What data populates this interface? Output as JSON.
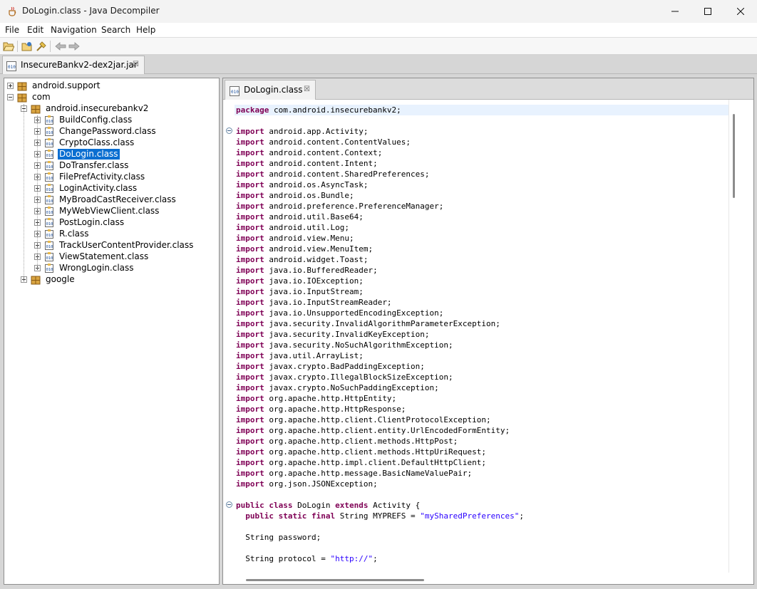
{
  "window": {
    "title": "DoLogin.class - Java Decompiler"
  },
  "menu": [
    "File",
    "Edit",
    "Navigation",
    "Search",
    "Help"
  ],
  "toolbar": {
    "icons": [
      "open-file-icon",
      "open-type-icon",
      "search-icon",
      "back-arrow-icon",
      "forward-arrow-icon"
    ]
  },
  "file_tab": {
    "label": "InsecureBankv2-dex2jar.jar",
    "close": "☒"
  },
  "editor_tab": {
    "label": "DoLogin.class",
    "close": "☒"
  },
  "tree": [
    {
      "label": "android.support",
      "level": 0,
      "expanded": false,
      "type": "package"
    },
    {
      "label": "com",
      "level": 0,
      "expanded": true,
      "type": "package"
    },
    {
      "label": "android.insecurebankv2",
      "level": 1,
      "expanded": true,
      "type": "package"
    },
    {
      "label": "BuildConfig.class",
      "level": 2,
      "expanded": false,
      "type": "class"
    },
    {
      "label": "ChangePassword.class",
      "level": 2,
      "expanded": false,
      "type": "class"
    },
    {
      "label": "CryptoClass.class",
      "level": 2,
      "expanded": false,
      "type": "class"
    },
    {
      "label": "DoLogin.class",
      "level": 2,
      "expanded": false,
      "type": "class",
      "selected": true
    },
    {
      "label": "DoTransfer.class",
      "level": 2,
      "expanded": false,
      "type": "class"
    },
    {
      "label": "FilePrefActivity.class",
      "level": 2,
      "expanded": false,
      "type": "class"
    },
    {
      "label": "LoginActivity.class",
      "level": 2,
      "expanded": false,
      "type": "class"
    },
    {
      "label": "MyBroadCastReceiver.class",
      "level": 2,
      "expanded": false,
      "type": "class"
    },
    {
      "label": "MyWebViewClient.class",
      "level": 2,
      "expanded": false,
      "type": "class"
    },
    {
      "label": "PostLogin.class",
      "level": 2,
      "expanded": false,
      "type": "class"
    },
    {
      "label": "R.class",
      "level": 2,
      "expanded": false,
      "type": "class"
    },
    {
      "label": "TrackUserContentProvider.class",
      "level": 2,
      "expanded": false,
      "type": "class"
    },
    {
      "label": "ViewStatement.class",
      "level": 2,
      "expanded": false,
      "type": "class"
    },
    {
      "label": "WrongLogin.class",
      "level": 2,
      "expanded": false,
      "type": "class"
    },
    {
      "label": "google",
      "level": 1,
      "expanded": false,
      "type": "package"
    }
  ],
  "code": [
    {
      "kw": "package",
      "text": " com.android.insecurebankv2;"
    },
    {
      "text": ""
    },
    {
      "kw": "import",
      "text": " android.app.Activity;"
    },
    {
      "kw": "import",
      "text": " android.content.ContentValues;"
    },
    {
      "kw": "import",
      "text": " android.content.Context;"
    },
    {
      "kw": "import",
      "text": " android.content.Intent;"
    },
    {
      "kw": "import",
      "text": " android.content.SharedPreferences;"
    },
    {
      "kw": "import",
      "text": " android.os.AsyncTask;"
    },
    {
      "kw": "import",
      "text": " android.os.Bundle;"
    },
    {
      "kw": "import",
      "text": " android.preference.PreferenceManager;"
    },
    {
      "kw": "import",
      "text": " android.util.Base64;"
    },
    {
      "kw": "import",
      "text": " android.util.Log;"
    },
    {
      "kw": "import",
      "text": " android.view.Menu;"
    },
    {
      "kw": "import",
      "text": " android.view.MenuItem;"
    },
    {
      "kw": "import",
      "text": " android.widget.Toast;"
    },
    {
      "kw": "import",
      "text": " java.io.BufferedReader;"
    },
    {
      "kw": "import",
      "text": " java.io.IOException;"
    },
    {
      "kw": "import",
      "text": " java.io.InputStream;"
    },
    {
      "kw": "import",
      "text": " java.io.InputStreamReader;"
    },
    {
      "kw": "import",
      "text": " java.io.UnsupportedEncodingException;"
    },
    {
      "kw": "import",
      "text": " java.security.InvalidAlgorithmParameterException;"
    },
    {
      "kw": "import",
      "text": " java.security.InvalidKeyException;"
    },
    {
      "kw": "import",
      "text": " java.security.NoSuchAlgorithmException;"
    },
    {
      "kw": "import",
      "text": " java.util.ArrayList;"
    },
    {
      "kw": "import",
      "text": " javax.crypto.BadPaddingException;"
    },
    {
      "kw": "import",
      "text": " javax.crypto.IllegalBlockSizeException;"
    },
    {
      "kw": "import",
      "text": " javax.crypto.NoSuchPaddingException;"
    },
    {
      "kw": "import",
      "text": " org.apache.http.HttpEntity;"
    },
    {
      "kw": "import",
      "text": " org.apache.http.HttpResponse;"
    },
    {
      "kw": "import",
      "text": " org.apache.http.client.ClientProtocolException;"
    },
    {
      "kw": "import",
      "text": " org.apache.http.client.entity.UrlEncodedFormEntity;"
    },
    {
      "kw": "import",
      "text": " org.apache.http.client.methods.HttpPost;"
    },
    {
      "kw": "import",
      "text": " org.apache.http.client.methods.HttpUriRequest;"
    },
    {
      "kw": "import",
      "text": " org.apache.http.impl.client.DefaultHttpClient;"
    },
    {
      "kw": "import",
      "text": " org.apache.http.message.BasicNameValuePair;"
    },
    {
      "kw": "import",
      "text": " org.json.JSONException;"
    },
    {
      "text": ""
    },
    {
      "kw": "public class",
      "text": " DoLogin ",
      "kw2": "extends",
      "text2": " Activity {"
    },
    {
      "indent": "  ",
      "kw": "public static final",
      "text": " String MYPREFS = ",
      "str": "\"mySharedPreferences\"",
      "text2": ";"
    },
    {
      "text": ""
    },
    {
      "indent": "  ",
      "text": "String password;"
    },
    {
      "text": ""
    },
    {
      "indent": "  ",
      "text": "String protocol = ",
      "str": "\"http://\"",
      "text2": ";"
    }
  ]
}
